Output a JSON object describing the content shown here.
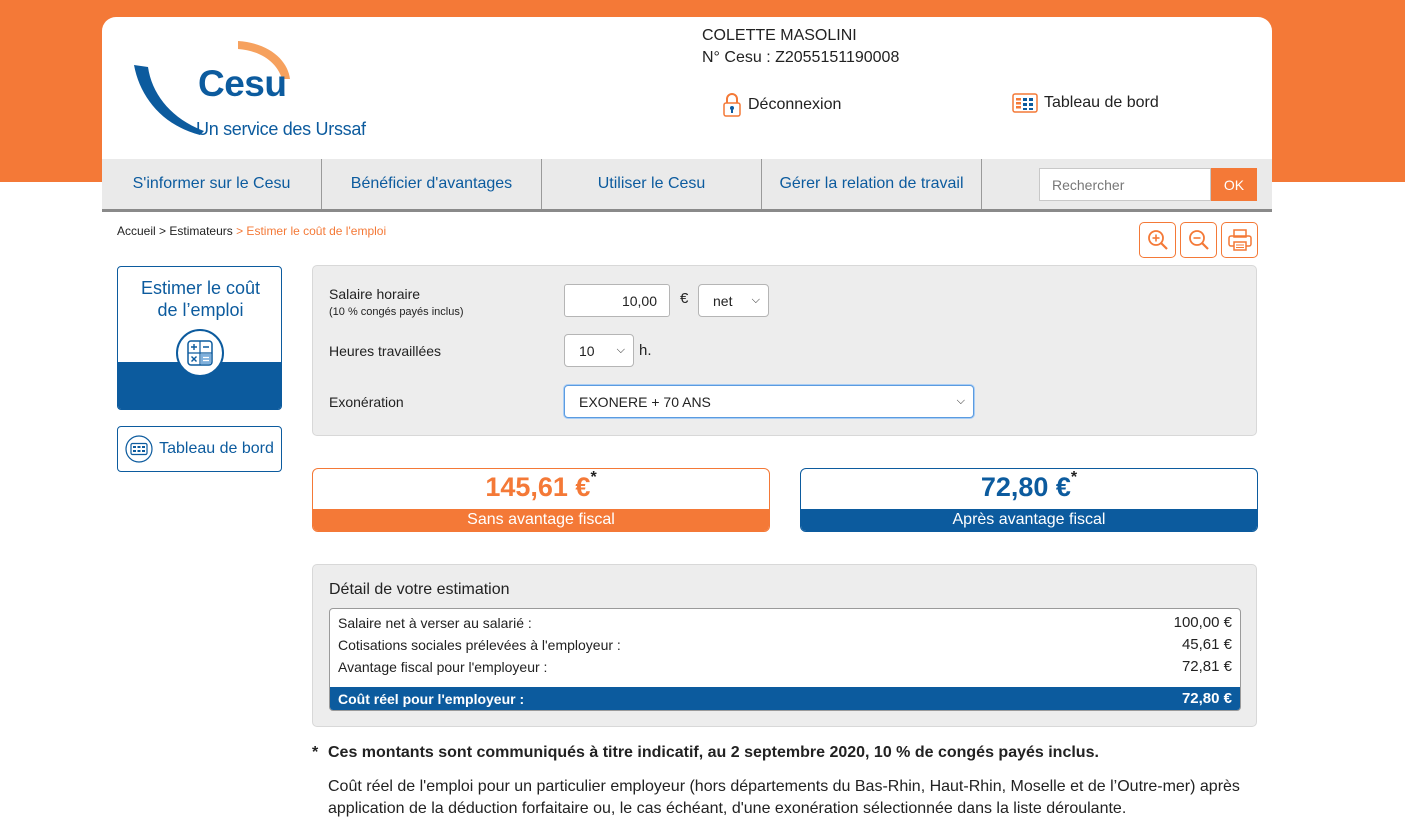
{
  "brand": {
    "logo_word": "Cesu",
    "tagline": "Un service des Urssaf",
    "orange": "#f47937",
    "blue": "#0c5b9e"
  },
  "user": {
    "name": "COLETTE MASOLINI",
    "cesu_number": "N° Cesu : Z2055151190008"
  },
  "header_links": {
    "logout": "Déconnexion",
    "dashboard": "Tableau de bord"
  },
  "nav": {
    "items": [
      "S'informer sur le Cesu",
      "Bénéficier d'avantages",
      "Utiliser le Cesu",
      "Gérer la relation de travail"
    ],
    "search_placeholder": "Rechercher",
    "search_button": "OK"
  },
  "breadcrumb": {
    "home": "Accueil",
    "sep": ">",
    "parent": "Estimateurs",
    "current": "> Estimer le coût de l'emploi"
  },
  "sidebar": {
    "card_title_line1": "Estimer le coût",
    "card_title_line2": "de l’emploi",
    "dashboard_label": "Tableau de bord"
  },
  "form": {
    "hourly_label": "Salaire horaire",
    "hourly_sub": "(10 % congés payés inclus)",
    "hourly_value": "10,00",
    "currency": "€",
    "net_option": "net",
    "hours_label": "Heures travaillées",
    "hours_value": "10",
    "hours_unit": "h.",
    "exo_label": "Exonération",
    "exo_value": "EXONERE + 70 ANS"
  },
  "results": {
    "without_amount": "145,61 €",
    "without_label": "Sans avantage fiscal",
    "with_amount": "72,80 €",
    "with_label": "Après avantage fiscal",
    "star": "*"
  },
  "detail": {
    "title": "Détail de votre estimation",
    "rows": [
      {
        "label": "Salaire net à verser au salarié :",
        "value": "100,00 €"
      },
      {
        "label": "Cotisations sociales prélevées à l'employeur :",
        "value": "45,61 €"
      },
      {
        "label": "Avantage fiscal pour l'employeur :",
        "value": "72,81 €"
      }
    ],
    "total_label": "Coût réel pour l'employeur :",
    "total_value": "72,80 €"
  },
  "notes": {
    "star": "*",
    "bold": "Ces montants sont communiqués à titre indicatif, au 2 septembre 2020, 10 % de congés payés inclus.",
    "text": "Coût réel de l'emploi pour un particulier employeur (hors départements du Bas-Rhin, Haut-Rhin, Moselle et de l’Outre-mer) après application de la déduction forfaitaire ou, le cas échéant, d'une exonération sélectionnée dans la liste déroulante."
  }
}
